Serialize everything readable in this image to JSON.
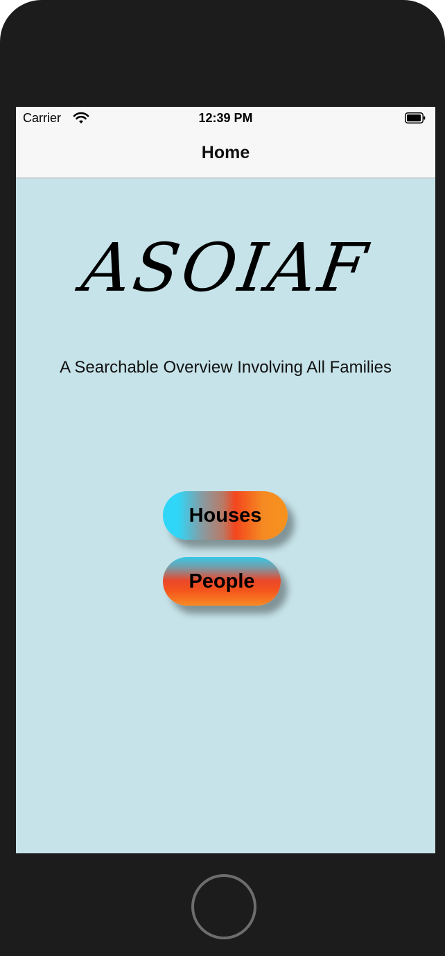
{
  "status_bar": {
    "carrier": "Carrier",
    "time": "12:39 PM",
    "icons": [
      "wifi-icon",
      "battery-icon"
    ]
  },
  "nav": {
    "title": "Home"
  },
  "main": {
    "logo_text": "ASOIAF",
    "subtitle": "A Searchable Overview Involving All Families",
    "buttons": [
      {
        "label": "Houses"
      },
      {
        "label": "People"
      }
    ]
  },
  "colors": {
    "background": "#c6e3e9",
    "bar_background": "#f7f7f7",
    "gradient_cyan": "#2fd6f8",
    "gradient_red": "#f4461e",
    "gradient_orange": "#f7921e",
    "device_frame": "#1c1c1c"
  }
}
